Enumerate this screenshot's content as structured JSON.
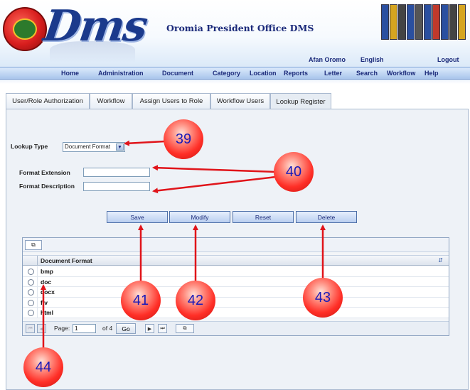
{
  "header": {
    "logo_text": "Dms",
    "app_title": "Oromia President Office DMS",
    "languages": [
      "Afan Oromo",
      "English"
    ],
    "logout": "Logout"
  },
  "nav": [
    "Home",
    "Administration",
    "Document",
    "Category",
    "Location",
    "Reports",
    "Letter",
    "Search",
    "Workflow",
    "Help"
  ],
  "tabs": [
    {
      "label": "User/Role Authorization",
      "active": false
    },
    {
      "label": "Workflow",
      "active": false
    },
    {
      "label": "Assign Users to Role",
      "active": false
    },
    {
      "label": "Workflow Users",
      "active": false
    },
    {
      "label": "Lookup Register",
      "active": true
    }
  ],
  "form": {
    "lookup_type_label": "Lookup Type",
    "lookup_type_value": "Document Format",
    "format_extension_label": "Format Extension",
    "format_description_label": "Format Description"
  },
  "buttons": [
    "Save",
    "Modify",
    "Reset",
    "Delete"
  ],
  "grid": {
    "column": "Document Format",
    "rows": [
      "bmp",
      "doc",
      "docx",
      "flv",
      "html"
    ],
    "pager": {
      "page_label": "Page:",
      "page_value": "1",
      "of_label": "of 4",
      "go_label": "Go"
    }
  },
  "callouts": [
    "39",
    "40",
    "41",
    "42",
    "43",
    "44"
  ],
  "colors": {
    "callout": "#e8231c",
    "arrow": "#e0141a",
    "nav_text": "#1b2a7a"
  }
}
